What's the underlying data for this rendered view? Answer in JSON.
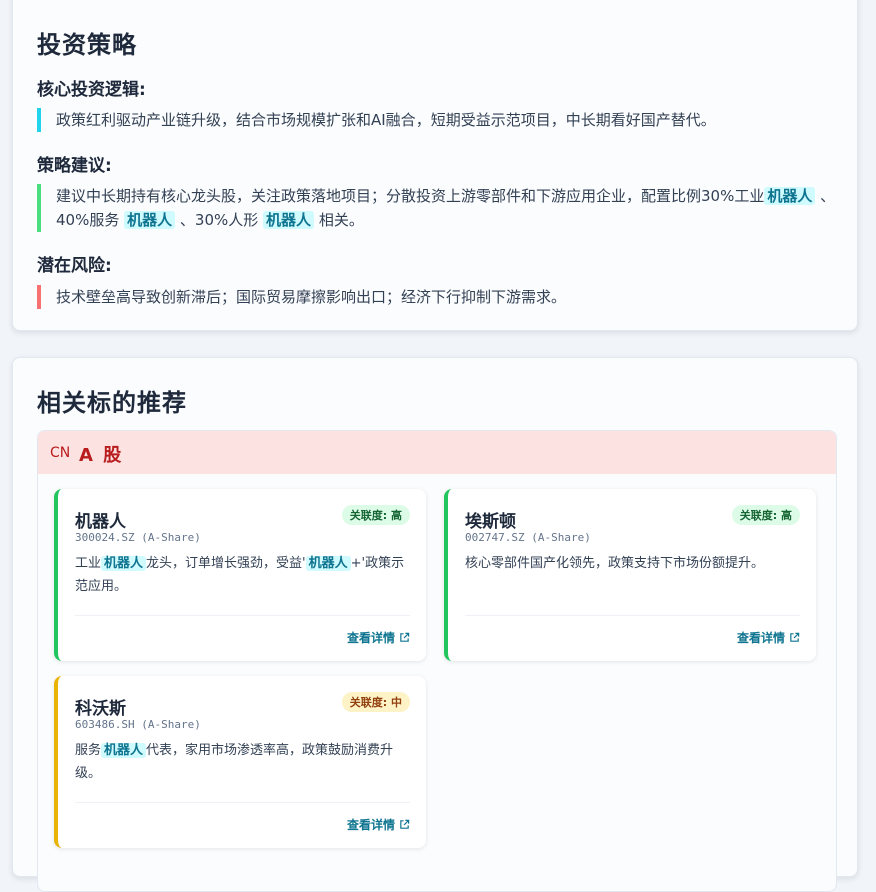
{
  "strategy": {
    "title": "投资策略",
    "core_logic": {
      "heading": "核心投资逻辑:",
      "text": "政策红利驱动产业链升级，结合市场规模扩张和AI融合，短期受益示范项目，中长期看好国产替代。",
      "accent": "#22d3ee"
    },
    "advice": {
      "heading": "策略建议:",
      "part1": "建议中长期持有核心龙头股，关注政策落地项目；分散投资上游零部件和下游应用企业，配置比例30%工业",
      "hl1": "机器人",
      "part2": "、40%服务",
      "hl2": "机器人",
      "part3": "、30%人形",
      "hl3": "机器人",
      "part4": "相关。",
      "accent": "#4ade80"
    },
    "risks": {
      "heading": "潜在风险:",
      "text": "技术壁垒高导致创新滞后；国际贸易摩擦影响出口；经济下行抑制下游需求。",
      "accent": "#f87171"
    }
  },
  "picks": {
    "title": "相关标的推荐",
    "group": {
      "flag": "CN",
      "label": "A 股"
    },
    "stocks": [
      {
        "name": "机器人",
        "code": "300024.SZ (A-Share)",
        "badge": "关联度: 高",
        "desc_a": "工业",
        "desc_hl1": "机器人",
        "desc_b": "龙头，订单增长强劲，受益'",
        "desc_hl2": "机器人",
        "desc_c": "+'政策示范应用。",
        "more": "查看详情"
      },
      {
        "name": "埃斯顿",
        "code": "002747.SZ (A-Share)",
        "badge": "关联度: 高",
        "desc": "核心零部件国产化领先，政策支持下市场份额提升。",
        "more": "查看详情"
      },
      {
        "name": "科沃斯",
        "code": "603486.SH (A-Share)",
        "badge": "关联度: 中",
        "desc_a": "服务",
        "desc_hl1": "机器人",
        "desc_b": "代表，家用市场渗透率高，政策鼓励消费升级。",
        "more": "查看详情"
      }
    ],
    "colors": {
      "high": "#22c55e",
      "mid": "#eab308"
    }
  }
}
